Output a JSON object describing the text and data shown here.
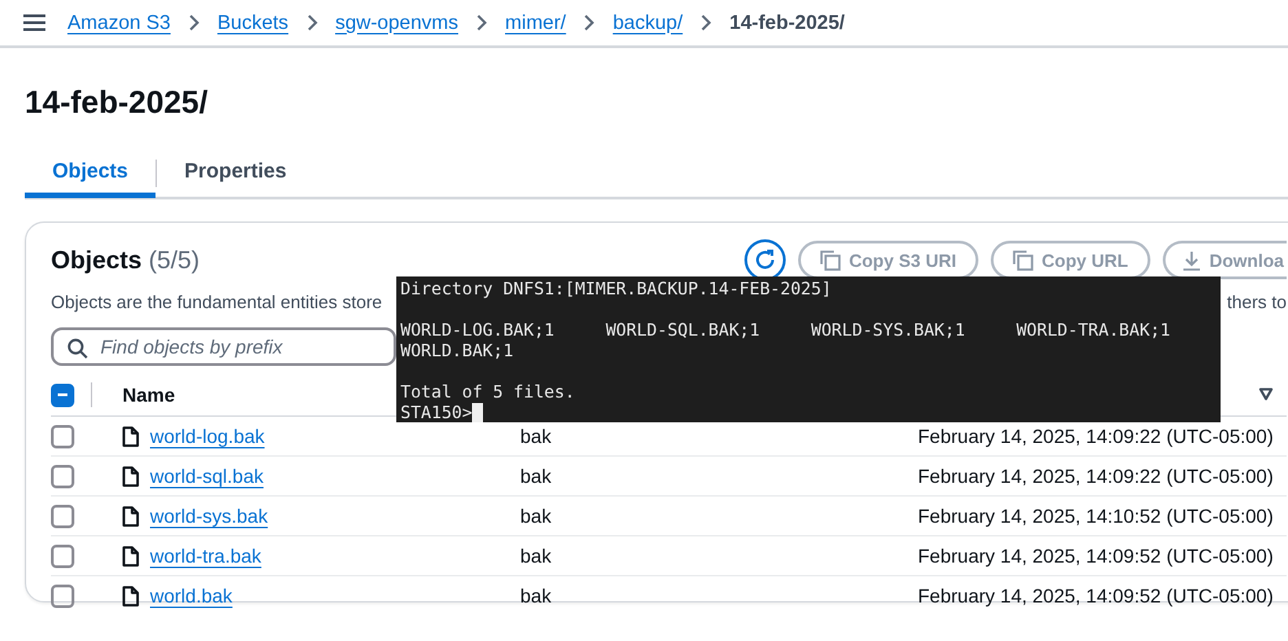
{
  "breadcrumbs": [
    "Amazon S3",
    "Buckets",
    "sgw-openvms",
    "mimer/",
    "backup/"
  ],
  "current_page": "14-feb-2025/",
  "title": "14-feb-2025/",
  "tabs": [
    {
      "label": "Objects",
      "selected": true
    },
    {
      "label": "Properties",
      "selected": false
    }
  ],
  "objects_panel": {
    "heading": "Objects",
    "count": "(5/5)",
    "description": "Objects are the fundamental entities store",
    "description_tail": "thers to",
    "buttons": [
      {
        "kind": "refresh"
      },
      {
        "kind": "copy",
        "label": "Copy S3 URI"
      },
      {
        "kind": "copy",
        "label": "Copy URL"
      },
      {
        "kind": "download",
        "label": "Downloa"
      }
    ],
    "search": {
      "placeholder": "Find objects by prefix"
    },
    "select_all": {
      "indeterminate": true
    },
    "columns": [
      "Name"
    ],
    "rows": [
      {
        "name": "world-log.bak",
        "type": "bak",
        "last_modified": "February 14, 2025, 14:09:22 (UTC-05:00)",
        "checked": false
      },
      {
        "name": "world-sql.bak",
        "type": "bak",
        "last_modified": "February 14, 2025, 14:09:22 (UTC-05:00)",
        "checked": false
      },
      {
        "name": "world-sys.bak",
        "type": "bak",
        "last_modified": "February 14, 2025, 14:10:52 (UTC-05:00)",
        "checked": false
      },
      {
        "name": "world-tra.bak",
        "type": "bak",
        "last_modified": "February 14, 2025, 14:09:52 (UTC-05:00)",
        "checked": false
      },
      {
        "name": "world.bak",
        "type": "bak",
        "last_modified": "February 14, 2025, 14:09:52 (UTC-05:00)",
        "checked": false
      }
    ]
  },
  "terminal": {
    "blocks": [
      [
        "Directory DNFS1:[MIMER.BACKUP.14-FEB-2025]"
      ],
      [
        "WORLD-LOG.BAK;1     WORLD-SQL.BAK;1     WORLD-SYS.BAK;1     WORLD-TRA.BAK;1",
        "WORLD.BAK;1"
      ],
      [
        "Total of 5 files."
      ]
    ],
    "prompt": "STA150>"
  }
}
